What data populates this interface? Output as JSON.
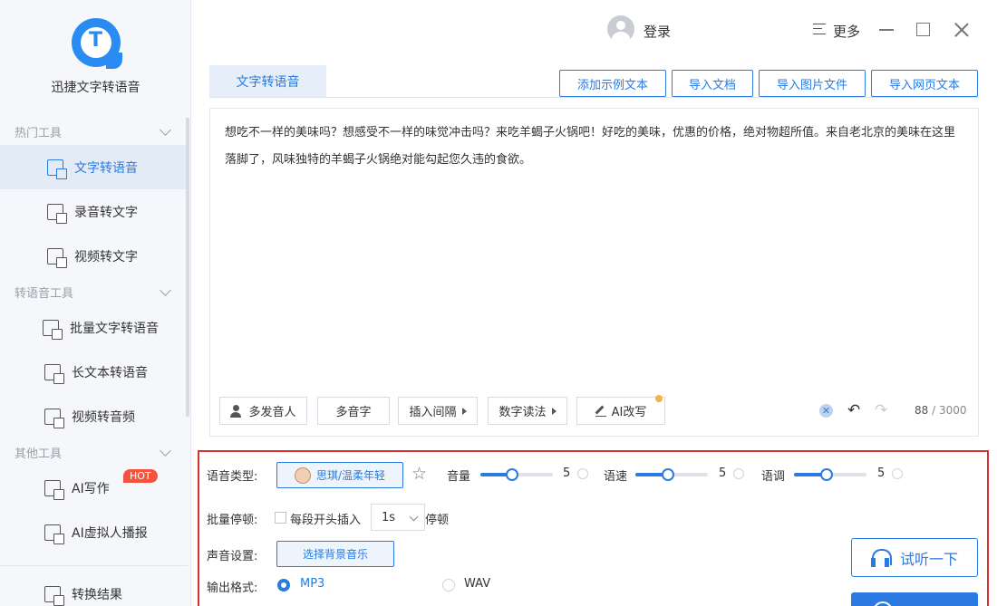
{
  "app": {
    "name": "迅捷文字转语音",
    "logo_letter": "T"
  },
  "sidebar": {
    "sections": [
      {
        "title": "热门工具"
      },
      {
        "title": "转语音工具"
      },
      {
        "title": "其他工具"
      }
    ],
    "items": [
      {
        "label": "文字转语音",
        "icon": "text-to-speech-icon"
      },
      {
        "label": "录音转文字",
        "icon": "audio-to-text-icon"
      },
      {
        "label": "视频转文字",
        "icon": "video-to-text-icon"
      },
      {
        "label": "批量文字转语音",
        "icon": "batch-tts-icon"
      },
      {
        "label": "长文本转语音",
        "icon": "long-text-icon"
      },
      {
        "label": "视频转音频",
        "icon": "video-to-audio-icon"
      },
      {
        "label": "AI写作",
        "icon": "ai-writing-icon"
      },
      {
        "label": "AI虚拟人播报",
        "icon": "virtual-anchor-icon"
      },
      {
        "label": "转换结果",
        "icon": "result-icon"
      }
    ],
    "hot_badge": "HOT"
  },
  "header": {
    "login": "登录",
    "more": "更多"
  },
  "main": {
    "tab": "文字转语音",
    "actions": [
      "添加示例文本",
      "导入文档",
      "导入图片文件",
      "导入网页文本"
    ],
    "editor_text": "想吃不一样的美味吗？想感受不一样的味觉冲击吗？来吃羊蝎子火锅吧！好吃的美味，优惠的价格，绝对物超所值。来自老北京的美味在这里落脚了，风味独特的羊蝎子火锅绝对能勾起您久违的食欲。",
    "tools": [
      "多发音人",
      "多音字",
      "插入间隔",
      "数字读法",
      "AI改写"
    ],
    "count_current": "88",
    "count_max": "/ 3000"
  },
  "settings": {
    "voice_type_label": "语音类型:",
    "voice_name": "思琪/温柔年轻",
    "volume_label": "音量",
    "volume": 5,
    "speed_label": "语速",
    "speed": 5,
    "pitch_label": "语调",
    "pitch": 5,
    "pause_label": "批量停顿:",
    "pause_checkbox_label": "每段开头插入",
    "pause_value": "1s",
    "pause_suffix": "停顿",
    "sound_label": "声音设置:",
    "bgm_button": "选择背景音乐",
    "format_label": "输出格式:",
    "formats": [
      "MP3",
      "WAV"
    ],
    "selected_format": "MP3",
    "preview_button": "试听一下"
  },
  "colors": {
    "accent": "#2a7ae2",
    "highlight_border": "#d9302c",
    "hot": "#f5533d"
  }
}
